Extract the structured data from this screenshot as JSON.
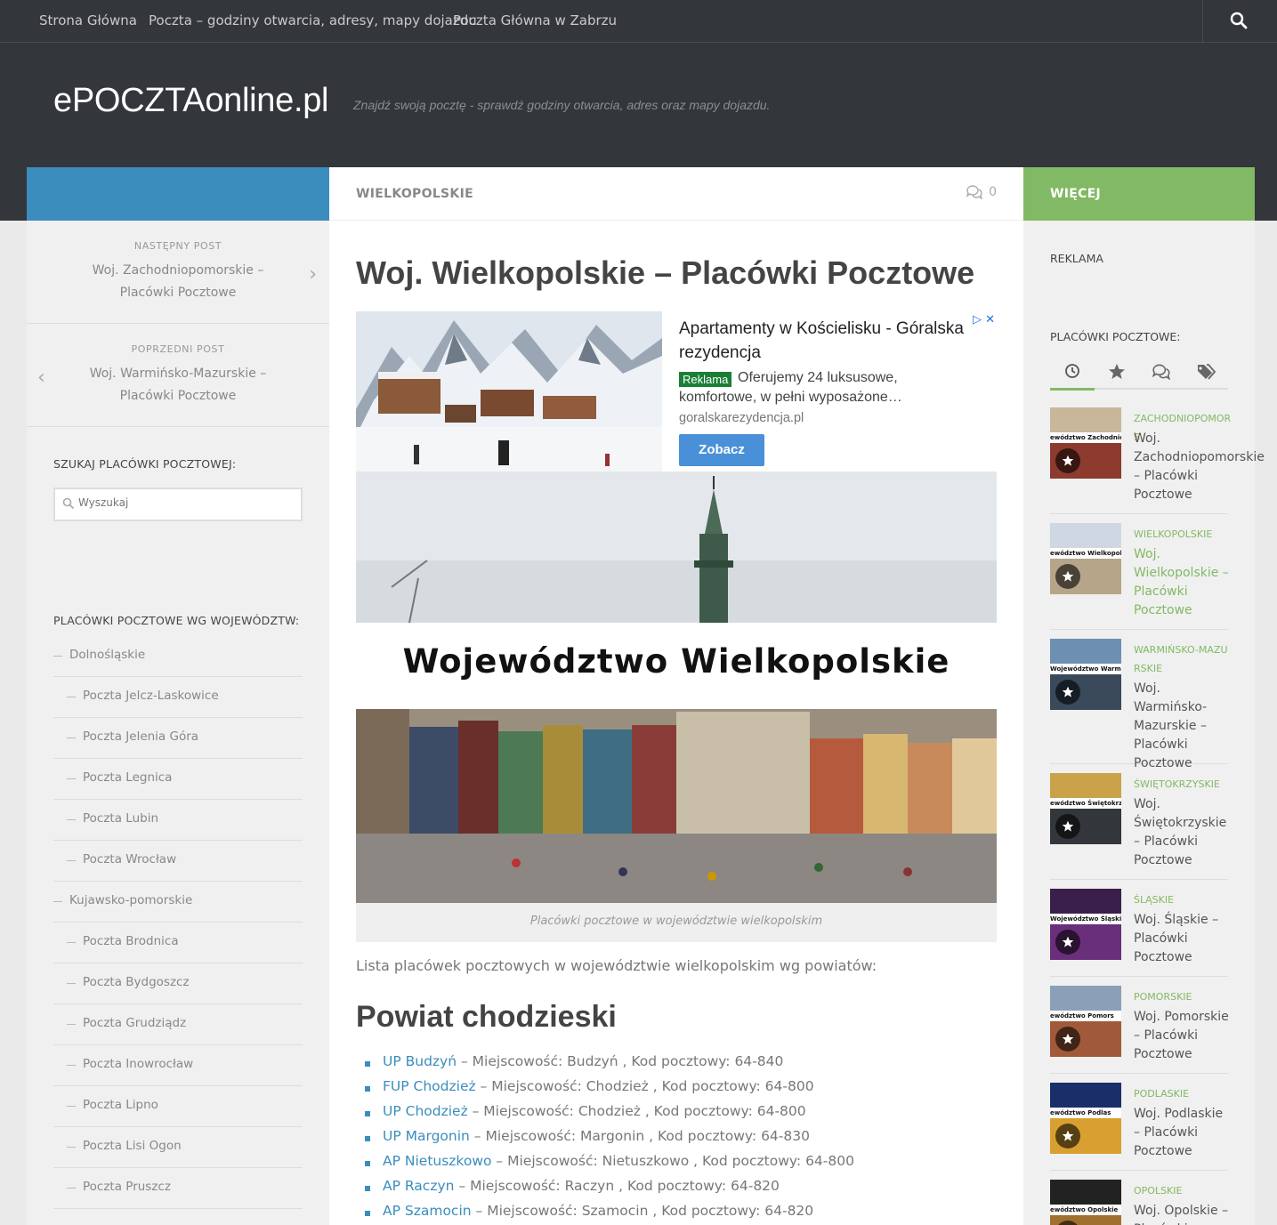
{
  "topnav": {
    "items": [
      "Strona Główna",
      "Poczta – godziny otwarcia, adresy, mapy dojazdu",
      "Poczta Główna w Zabrzu"
    ]
  },
  "header": {
    "logo": "ePOCZTAonline.pl",
    "tagline": "Znajdź swoją pocztę - sprawdź godziny otwarcia, adres oraz mapy dojazdu."
  },
  "colheads": {
    "category": "WIELKOPOLSKIE",
    "comments": "0",
    "more": "WIĘCEJ"
  },
  "sidebar_left": {
    "next_label": "NASTĘPNY POST",
    "next_title": "Woj. Zachodniopomorskie – Placówki Pocztowe",
    "prev_label": "POPRZEDNI POST",
    "prev_title": "Woj. Warmińsko-Mazurskie – Placówki Pocztowe",
    "search_title": "SZUKAJ PLACÓWKI POCZTOWEJ:",
    "search_placeholder": "Wyszukaj",
    "cats_title": "PLACÓWKI POCZTOWE WG WOJEWÓDZTW:",
    "cats": [
      {
        "label": "Dolnośląskie",
        "level": 0
      },
      {
        "label": "Poczta Jelcz-Laskowice",
        "level": 1
      },
      {
        "label": "Poczta Jelenia Góra",
        "level": 1
      },
      {
        "label": "Poczta Legnica",
        "level": 1
      },
      {
        "label": "Poczta Lubin",
        "level": 1
      },
      {
        "label": "Poczta Wrocław",
        "level": 1
      },
      {
        "label": "Kujawsko-pomorskie",
        "level": 0
      },
      {
        "label": "Poczta Brodnica",
        "level": 1
      },
      {
        "label": "Poczta Bydgoszcz",
        "level": 1
      },
      {
        "label": "Poczta Grudziądz",
        "level": 1
      },
      {
        "label": "Poczta Inowrocław",
        "level": 1
      },
      {
        "label": "Poczta Lipno",
        "level": 1
      },
      {
        "label": "Poczta Lisi Ogon",
        "level": 1
      },
      {
        "label": "Poczta Pruszcz",
        "level": 1
      }
    ]
  },
  "main": {
    "title": "Woj. Wielkopolskie – Placówki Pocztowe",
    "ad": {
      "headline": "Apartamenty w Kościelisku - Góralska rezydencja",
      "badge": "Reklama",
      "desc": "Oferujemy 24 luksusowe, komfortowe, w pełni wyposażone…",
      "url": "goralskarezydencja.pl",
      "button": "Zobacz"
    },
    "banner_text": "Województwo Wielkopolskie",
    "caption": "Placówki pocztowe w województwie wielkopolskim",
    "intro": "Lista placówek pocztowych w województwie wielkopolskim wg powiatów:",
    "section_title": "Powiat chodzieski",
    "offices": [
      {
        "link": "UP Budzyń",
        "rest": " – Miejscowość: Budzyń , Kod pocztowy: 64-840"
      },
      {
        "link": "FUP Chodzież",
        "rest": " – Miejscowość: Chodzież , Kod pocztowy: 64-800"
      },
      {
        "link": "UP Chodzież",
        "rest": " – Miejscowość: Chodzież , Kod pocztowy: 64-800"
      },
      {
        "link": "UP Margonin",
        "rest": " – Miejscowość: Margonin , Kod pocztowy: 64-830"
      },
      {
        "link": "AP Nietuszkowo",
        "rest": " – Miejscowość: Nietuszkowo , Kod pocztowy: 64-800"
      },
      {
        "link": "AP Raczyn",
        "rest": " – Miejscowość: Raczyn , Kod pocztowy: 64-820"
      },
      {
        "link": "AP Szamocin",
        "rest": " – Miejscowość: Szamocin , Kod pocztowy: 64-820"
      }
    ]
  },
  "sidebar_right": {
    "ad_title": "REKLAMA",
    "posts_title": "PLACÓWKI POCZTOWE:",
    "tabs": [
      "clock-icon",
      "star-icon",
      "comments-icon",
      "tags-icon"
    ],
    "posts": [
      {
        "cat": "ZACHODNIOPOMORS",
        "title": "Woj. Zachodniopomorskie – Placówki Pocztowe",
        "thumb_label": "ewództwo Zachodniopo",
        "active": false
      },
      {
        "cat": "WIELKOPOLSKIE",
        "title": "Woj. Wielkopolskie – Placówki Pocztowe",
        "thumb_label": "ewództwo Wielkopol",
        "active": true
      },
      {
        "cat": "WARMIŃSKO-MAZURSKIE",
        "title": "Woj. Warmińsko-Mazurskie – Placówki Pocztowe",
        "thumb_label": "Województwo Warmińsko-Mazurskie",
        "active": false
      },
      {
        "cat": "ŚWIĘTOKRZYSKIE",
        "title": "Woj. Świętokrzyskie – Placówki Pocztowe",
        "thumb_label": "ewództwo Świętokrzy",
        "active": false
      },
      {
        "cat": "ŚLĄSKIE",
        "title": "Woj. Śląskie – Placówki Pocztowe",
        "thumb_label": "Województwo Śląskie",
        "active": false
      },
      {
        "cat": "POMORSKIE",
        "title": "Woj. Pomorskie – Placówki Pocztowe",
        "thumb_label": "ewództwo Pomors",
        "active": false
      },
      {
        "cat": "PODLASKIE",
        "title": "Woj. Podlaskie – Placówki Pocztowe",
        "thumb_label": "ewództwo Podlas",
        "active": false
      },
      {
        "cat": "OPOLSKIE",
        "title": "Woj. Opolskie – Placówki Pocztowe",
        "thumb_label": "ewództwo Opolskie",
        "active": false
      }
    ]
  },
  "colors": {
    "dark": "#33363b",
    "blue": "#3b8dbd",
    "green": "#82b965"
  }
}
